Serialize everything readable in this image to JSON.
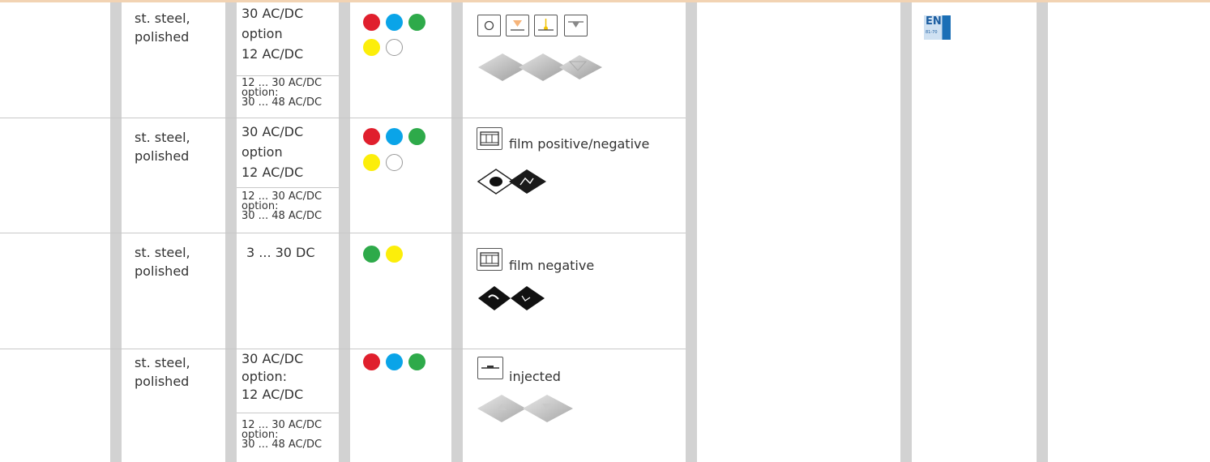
{
  "rows": [
    {
      "material": [
        "st. steel,",
        "polished"
      ],
      "voltage_main": [
        "30 AC/DC",
        "option",
        "12 AC/DC"
      ],
      "voltage_alt": [
        "12 ... 30 AC/DC",
        "option:",
        "30 ... 48 AC/DC"
      ],
      "colors": [
        "#e01f2d",
        "#0aa4e8",
        "#2eaa4a",
        "#fcee0a",
        "#ffffff"
      ],
      "symbol_label": "",
      "symbol_icons": [
        "circle-icon",
        "triangle-down-orange-icon",
        "tactile-marker-icon",
        "triangle-down-gray-icon"
      ],
      "image": "embossed-stainless-buttons"
    },
    {
      "material": [
        "st. steel,",
        "polished"
      ],
      "voltage_main": [
        "30 AC/DC",
        "option",
        "12 AC/DC"
      ],
      "voltage_alt": [
        "12 ... 30 AC/DC",
        "option:",
        "30 ... 48 AC/DC"
      ],
      "colors": [
        "#e01f2d",
        "#0aa4e8",
        "#2eaa4a",
        "#fcee0a",
        "#ffffff"
      ],
      "symbol_label": "film positive/negative",
      "symbol_icons": [
        "film-icon"
      ],
      "image": "film-positive-negative-buttons"
    },
    {
      "material": [
        "st. steel,",
        "polished"
      ],
      "voltage_main": [
        "3 ... 30 DC"
      ],
      "voltage_alt": [],
      "colors": [
        "#2eaa4a",
        "#fcee0a"
      ],
      "symbol_label": "film negative",
      "symbol_icons": [
        "film-icon"
      ],
      "image": "film-negative-buttons"
    },
    {
      "material": [
        "st. steel,",
        "polished"
      ],
      "voltage_main": [
        "30 AC/DC",
        "option:",
        "12 AC/DC"
      ],
      "voltage_alt": [
        "12 ... 30 AC/DC",
        "option:",
        "30 ... 48 AC/DC"
      ],
      "colors": [
        "#e01f2d",
        "#0aa4e8",
        "#2eaa4a"
      ],
      "symbol_label": "injected",
      "symbol_icons": [
        "injected-icon"
      ],
      "image": "injected-buttons"
    }
  ],
  "standard_badge": {
    "code": "EN",
    "number": "81-70"
  }
}
